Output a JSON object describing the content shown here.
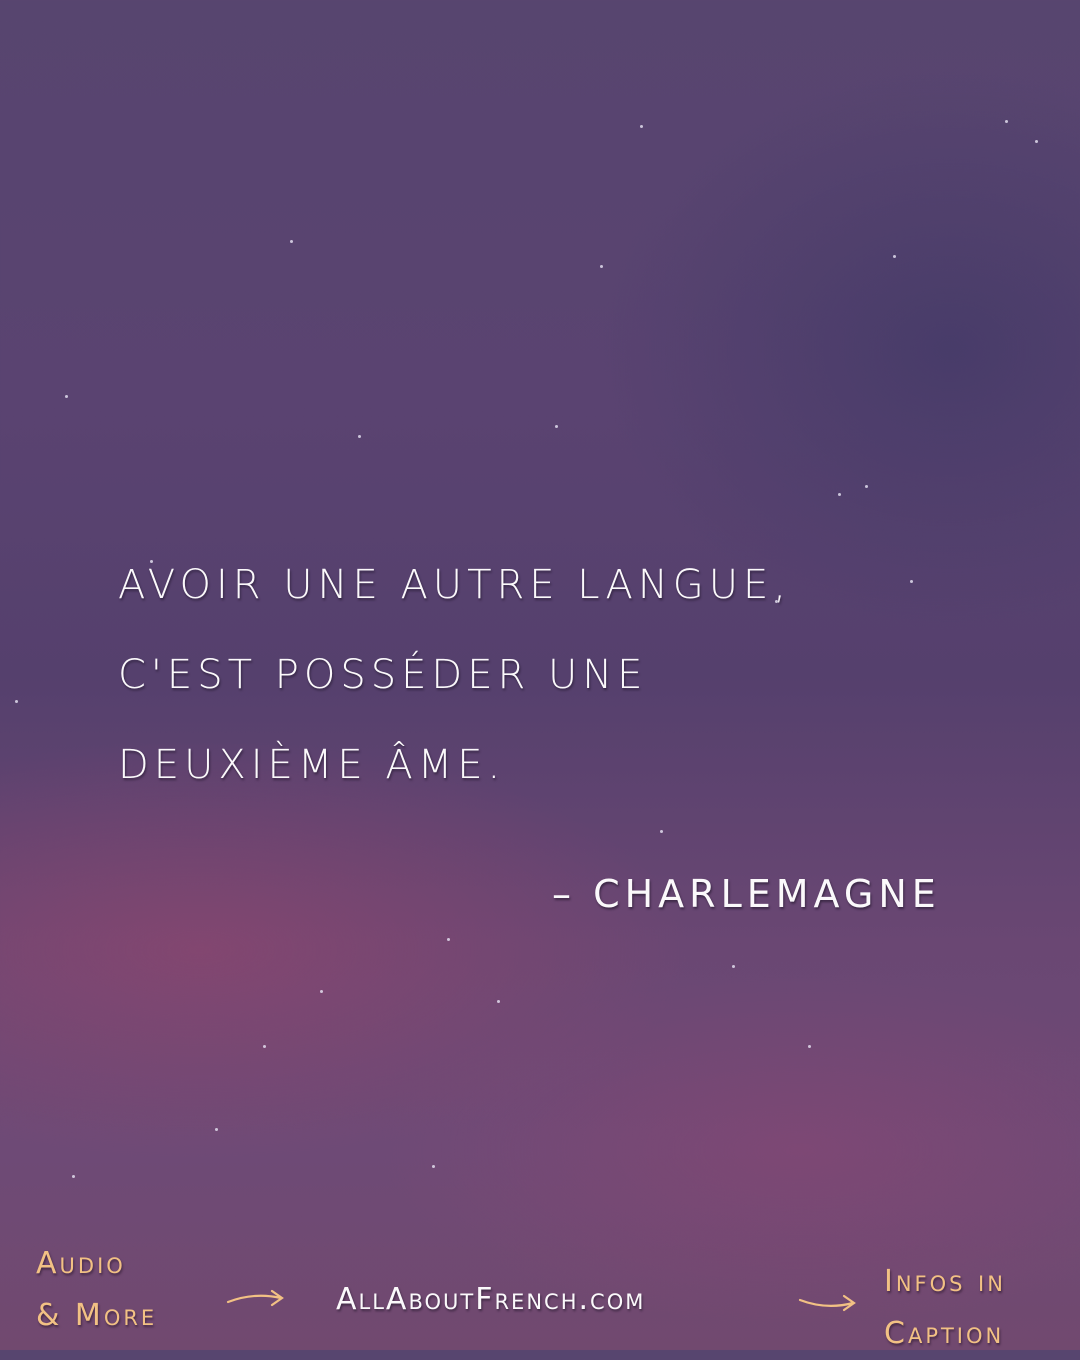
{
  "quote": {
    "lines": [
      "AVOIR UNE AUTRE LANGUE,",
      "C'EST POSSÉDER UNE",
      "DEUXIÈME ÂME."
    ],
    "author": "– CHARLEMAGNE"
  },
  "footer": {
    "left_line1": "Audio",
    "left_line2": "& More",
    "site": "AllAboutFrench.com",
    "right_line1": "Infos in",
    "right_line2": "Caption",
    "accent_color": "#f2c184"
  },
  "icons": [
    "arrow-right-icon",
    "arrow-right-icon"
  ]
}
